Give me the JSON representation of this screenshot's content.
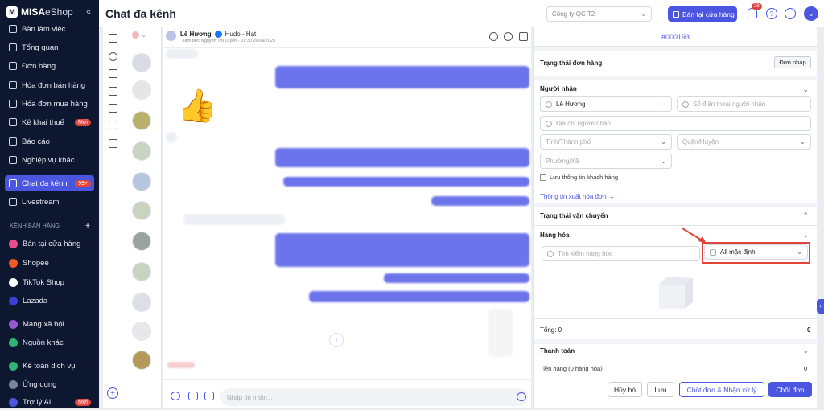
{
  "app": {
    "logo_mark": "M",
    "logo_bold": "MISA",
    "logo_rest": "eShop",
    "collapse": "«"
  },
  "sidebar": {
    "items": [
      {
        "label": "Bàn làm việc"
      },
      {
        "label": "Tổng quan"
      },
      {
        "label": "Đơn hàng"
      },
      {
        "label": "Hóa đơn bán hàng"
      },
      {
        "label": "Hóa đơn mua hàng"
      },
      {
        "label": "Kê khai thuế",
        "badge": "Mới"
      },
      {
        "label": "Báo cáo"
      },
      {
        "label": "Nghiệp vụ khác"
      },
      {
        "label": "Chat đa kênh",
        "badge": "99+"
      },
      {
        "label": "Livestream"
      }
    ],
    "section_label": "KÊNH BÁN HÀNG",
    "section_add": "+",
    "channels": [
      {
        "label": "Bán tại cửa hàng",
        "color": "#e94c8b"
      },
      {
        "label": "Shopee",
        "color": "#f05a26"
      },
      {
        "label": "TikTok Shop",
        "color": "#ffffff"
      },
      {
        "label": "Lazada",
        "color": "#3b3fd1"
      },
      {
        "label": "Mạng xã hội",
        "color": "#9b59d0"
      },
      {
        "label": "Nguồn khác",
        "color": "#2bb673"
      },
      {
        "label": "Kế toán dịch vụ",
        "color": "#2bb673"
      },
      {
        "label": "Ứng dụng",
        "color": "#7a84a0"
      },
      {
        "label": "Trợ lý AI",
        "badge": "Mới",
        "color": "#4b56e0"
      }
    ]
  },
  "header": {
    "title": "Chat đa kênh",
    "company": "Công ty QC T2",
    "store_button": "Bán tại cửa hàng",
    "notif_count": "28",
    "help": "?",
    "more": "···",
    "user": "⌄"
  },
  "chat": {
    "name": "Lê Hương",
    "page": "Hudo - Hạt",
    "sub": "Xem bởi: Nguyễn Thị Luyến - 01:30 26/09/2025",
    "input_placeholder": "Nhập tin nhắn...",
    "down": "↓",
    "thumb": "👍"
  },
  "order": {
    "id": "#000193",
    "status_label": "Trạng thái đơn hàng",
    "status_value": "Đơn nháp",
    "recipient": "Người nhận",
    "name_value": "Lê Hương",
    "phone_ph": "Số điện thoại người nhận",
    "address_ph": "Địa chỉ người nhận",
    "province_ph": "Tỉnh/Thành phố",
    "district_ph": "Quận/Huyện",
    "ward_ph": "Phường/Xã",
    "save_customer": "Lưu thông tin khách hàng",
    "invoice_link": "Thông tin xuất hóa đơn →",
    "shipping": "Trạng thái vận chuyển",
    "goods": "Hàng hóa",
    "search_goods_ph": "Tìm kiếm hàng hóa",
    "price_list": "All mặc định",
    "total_label": "Tổng: 0",
    "total_value": "0",
    "payment": "Thanh toán",
    "goods_amount": "Tiền hàng (0 hàng hóa)",
    "goods_amount_value": "0",
    "buttons": {
      "cancel": "Hủy bỏ",
      "save": "Lưu",
      "close_process": "Chốt đơn & Nhận xử lý",
      "close": "Chốt đơn"
    }
  }
}
